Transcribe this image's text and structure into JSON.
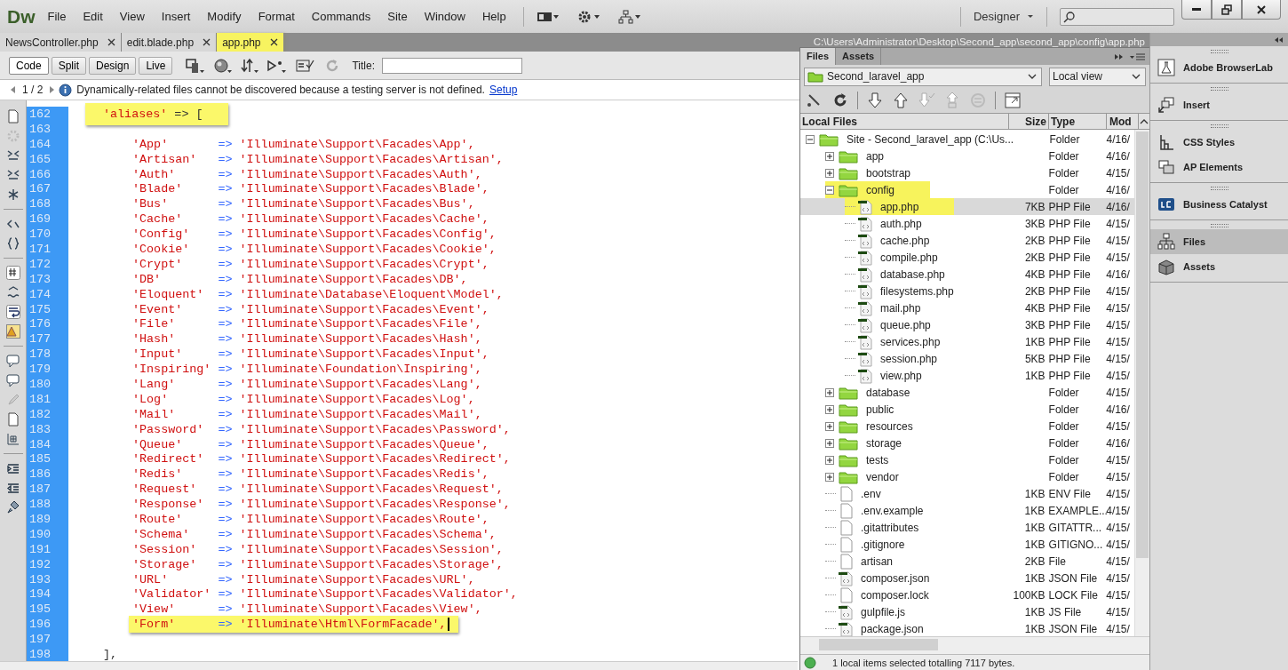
{
  "app_logo": "Dw",
  "menu": [
    "File",
    "Edit",
    "View",
    "Insert",
    "Modify",
    "Format",
    "Commands",
    "Site",
    "Window",
    "Help"
  ],
  "workspace": "Designer",
  "document_tabs": [
    {
      "label": "NewsController.php",
      "selected": false
    },
    {
      "label": "edit.blade.php",
      "selected": false
    },
    {
      "label": "app.php",
      "selected": true
    }
  ],
  "document_path": "C:\\Users\\Administrator\\Desktop\\Second_app\\second_app\\config\\app.php",
  "view_buttons": [
    {
      "label": "Code",
      "selected": true
    },
    {
      "label": "Split",
      "selected": false
    },
    {
      "label": "Design",
      "selected": false
    },
    {
      "label": "Live",
      "selected": false
    }
  ],
  "title_label": "Title:",
  "info_bar": {
    "pager": "1 / 2",
    "message": "Dynamically-related files cannot be discovered because a testing server is not defined.",
    "link": "Setup"
  },
  "code_lines": [
    {
      "number": "162",
      "kind": "open",
      "key": "'aliases'",
      "op": "=> [",
      "highlighted": true,
      "cursor": false
    },
    {
      "number": "163",
      "kind": "blank"
    },
    {
      "number": "164",
      "kind": "pair",
      "key": "'App'",
      "op": "=>",
      "value": "'Illuminate\\Support\\Facades\\App',",
      "highlighted": false,
      "cursor": false
    },
    {
      "number": "165",
      "kind": "pair",
      "key": "'Artisan'",
      "op": "=>",
      "value": "'Illuminate\\Support\\Facades\\Artisan',",
      "highlighted": false,
      "cursor": false
    },
    {
      "number": "166",
      "kind": "pair",
      "key": "'Auth'",
      "op": "=>",
      "value": "'Illuminate\\Support\\Facades\\Auth',",
      "highlighted": false,
      "cursor": false
    },
    {
      "number": "167",
      "kind": "pair",
      "key": "'Blade'",
      "op": "=>",
      "value": "'Illuminate\\Support\\Facades\\Blade',",
      "highlighted": false,
      "cursor": false
    },
    {
      "number": "168",
      "kind": "pair",
      "key": "'Bus'",
      "op": "=>",
      "value": "'Illuminate\\Support\\Facades\\Bus',",
      "highlighted": false,
      "cursor": false
    },
    {
      "number": "169",
      "kind": "pair",
      "key": "'Cache'",
      "op": "=>",
      "value": "'Illuminate\\Support\\Facades\\Cache',",
      "highlighted": false,
      "cursor": false
    },
    {
      "number": "170",
      "kind": "pair",
      "key": "'Config'",
      "op": "=>",
      "value": "'Illuminate\\Support\\Facades\\Config',",
      "highlighted": false,
      "cursor": false
    },
    {
      "number": "171",
      "kind": "pair",
      "key": "'Cookie'",
      "op": "=>",
      "value": "'Illuminate\\Support\\Facades\\Cookie',",
      "highlighted": false,
      "cursor": false
    },
    {
      "number": "172",
      "kind": "pair",
      "key": "'Crypt'",
      "op": "=>",
      "value": "'Illuminate\\Support\\Facades\\Crypt',",
      "highlighted": false,
      "cursor": false
    },
    {
      "number": "173",
      "kind": "pair",
      "key": "'DB'",
      "op": "=>",
      "value": "'Illuminate\\Support\\Facades\\DB',",
      "highlighted": false,
      "cursor": false
    },
    {
      "number": "174",
      "kind": "pair",
      "key": "'Eloquent'",
      "op": "=>",
      "value": "'Illuminate\\Database\\Eloquent\\Model',",
      "highlighted": false,
      "cursor": false
    },
    {
      "number": "175",
      "kind": "pair",
      "key": "'Event'",
      "op": "=>",
      "value": "'Illuminate\\Support\\Facades\\Event',",
      "highlighted": false,
      "cursor": false
    },
    {
      "number": "176",
      "kind": "pair",
      "key": "'File'",
      "op": "=>",
      "value": "'Illuminate\\Support\\Facades\\File',",
      "highlighted": false,
      "cursor": false
    },
    {
      "number": "177",
      "kind": "pair",
      "key": "'Hash'",
      "op": "=>",
      "value": "'Illuminate\\Support\\Facades\\Hash',",
      "highlighted": false,
      "cursor": false
    },
    {
      "number": "178",
      "kind": "pair",
      "key": "'Input'",
      "op": "=>",
      "value": "'Illuminate\\Support\\Facades\\Input',",
      "highlighted": false,
      "cursor": false
    },
    {
      "number": "179",
      "kind": "pair",
      "key": "'Inspiring'",
      "op": "=>",
      "value": "'Illuminate\\Foundation\\Inspiring',",
      "highlighted": false,
      "cursor": false
    },
    {
      "number": "180",
      "kind": "pair",
      "key": "'Lang'",
      "op": "=>",
      "value": "'Illuminate\\Support\\Facades\\Lang',",
      "highlighted": false,
      "cursor": false
    },
    {
      "number": "181",
      "kind": "pair",
      "key": "'Log'",
      "op": "=>",
      "value": "'Illuminate\\Support\\Facades\\Log',",
      "highlighted": false,
      "cursor": false
    },
    {
      "number": "182",
      "kind": "pair",
      "key": "'Mail'",
      "op": "=>",
      "value": "'Illuminate\\Support\\Facades\\Mail',",
      "highlighted": false,
      "cursor": false
    },
    {
      "number": "183",
      "kind": "pair",
      "key": "'Password'",
      "op": "=>",
      "value": "'Illuminate\\Support\\Facades\\Password',",
      "highlighted": false,
      "cursor": false
    },
    {
      "number": "184",
      "kind": "pair",
      "key": "'Queue'",
      "op": "=>",
      "value": "'Illuminate\\Support\\Facades\\Queue',",
      "highlighted": false,
      "cursor": false
    },
    {
      "number": "185",
      "kind": "pair",
      "key": "'Redirect'",
      "op": "=>",
      "value": "'Illuminate\\Support\\Facades\\Redirect',",
      "highlighted": false,
      "cursor": false
    },
    {
      "number": "186",
      "kind": "pair",
      "key": "'Redis'",
      "op": "=>",
      "value": "'Illuminate\\Support\\Facades\\Redis',",
      "highlighted": false,
      "cursor": false
    },
    {
      "number": "187",
      "kind": "pair",
      "key": "'Request'",
      "op": "=>",
      "value": "'Illuminate\\Support\\Facades\\Request',",
      "highlighted": false,
      "cursor": false
    },
    {
      "number": "188",
      "kind": "pair",
      "key": "'Response'",
      "op": "=>",
      "value": "'Illuminate\\Support\\Facades\\Response',",
      "highlighted": false,
      "cursor": false
    },
    {
      "number": "189",
      "kind": "pair",
      "key": "'Route'",
      "op": "=>",
      "value": "'Illuminate\\Support\\Facades\\Route',",
      "highlighted": false,
      "cursor": false
    },
    {
      "number": "190",
      "kind": "pair",
      "key": "'Schema'",
      "op": "=>",
      "value": "'Illuminate\\Support\\Facades\\Schema',",
      "highlighted": false,
      "cursor": false
    },
    {
      "number": "191",
      "kind": "pair",
      "key": "'Session'",
      "op": "=>",
      "value": "'Illuminate\\Support\\Facades\\Session',",
      "highlighted": false,
      "cursor": false
    },
    {
      "number": "192",
      "kind": "pair",
      "key": "'Storage'",
      "op": "=>",
      "value": "'Illuminate\\Support\\Facades\\Storage',",
      "highlighted": false,
      "cursor": false
    },
    {
      "number": "193",
      "kind": "pair",
      "key": "'URL'",
      "op": "=>",
      "value": "'Illuminate\\Support\\Facades\\URL',",
      "highlighted": false,
      "cursor": false
    },
    {
      "number": "194",
      "kind": "pair",
      "key": "'Validator'",
      "op": "=>",
      "value": "'Illuminate\\Support\\Facades\\Validator',",
      "highlighted": false,
      "cursor": false
    },
    {
      "number": "195",
      "kind": "pair",
      "key": "'View'",
      "op": "=>",
      "value": "'Illuminate\\Support\\Facades\\View',",
      "highlighted": false,
      "cursor": false
    },
    {
      "number": "196",
      "kind": "pair",
      "key": "'Form'",
      "op": "=>",
      "value": "'Illuminate\\Html\\FormFacade',",
      "highlighted": true,
      "cursor": true
    },
    {
      "number": "197",
      "kind": "blank"
    },
    {
      "number": "198",
      "kind": "close",
      "op": "],",
      "highlighted": false,
      "cursor": false
    }
  ],
  "files_panel": {
    "tabs": [
      {
        "label": "Files",
        "selected": true
      },
      {
        "label": "Assets",
        "selected": false
      }
    ],
    "site": "Second_laravel_app",
    "view": "Local view",
    "columns": [
      "Local Files",
      "Size",
      "Type",
      "Mod"
    ],
    "tree": [
      {
        "name": "Site - Second_laravel_app (C:\\Us...",
        "kind": "folder",
        "type": "Folder",
        "modified": "4/16/",
        "expanded": true,
        "selected": false,
        "highlighted": false,
        "children": [
          {
            "name": "app",
            "kind": "folder",
            "type": "Folder",
            "modified": "4/16/",
            "expanded": false,
            "selected": false,
            "highlighted": false
          },
          {
            "name": "bootstrap",
            "kind": "folder",
            "type": "Folder",
            "modified": "4/15/",
            "expanded": false,
            "selected": false,
            "highlighted": false
          },
          {
            "name": "config",
            "kind": "folder",
            "type": "Folder",
            "modified": "4/16/",
            "expanded": true,
            "selected": false,
            "highlighted": true,
            "children": [
              {
                "name": "app.php",
                "kind": "code",
                "size": "7KB",
                "type": "PHP File",
                "modified": "4/16/",
                "selected": true,
                "highlighted": true
              },
              {
                "name": "auth.php",
                "kind": "code",
                "size": "3KB",
                "type": "PHP File",
                "modified": "4/15/",
                "selected": false,
                "highlighted": false
              },
              {
                "name": "cache.php",
                "kind": "code",
                "size": "2KB",
                "type": "PHP File",
                "modified": "4/15/",
                "selected": false,
                "highlighted": false
              },
              {
                "name": "compile.php",
                "kind": "code",
                "size": "2KB",
                "type": "PHP File",
                "modified": "4/15/",
                "selected": false,
                "highlighted": false
              },
              {
                "name": "database.php",
                "kind": "code",
                "size": "4KB",
                "type": "PHP File",
                "modified": "4/16/",
                "selected": false,
                "highlighted": false
              },
              {
                "name": "filesystems.php",
                "kind": "code",
                "size": "2KB",
                "type": "PHP File",
                "modified": "4/15/",
                "selected": false,
                "highlighted": false
              },
              {
                "name": "mail.php",
                "kind": "code",
                "size": "4KB",
                "type": "PHP File",
                "modified": "4/15/",
                "selected": false,
                "highlighted": false
              },
              {
                "name": "queue.php",
                "kind": "code",
                "size": "3KB",
                "type": "PHP File",
                "modified": "4/15/",
                "selected": false,
                "highlighted": false
              },
              {
                "name": "services.php",
                "kind": "code",
                "size": "1KB",
                "type": "PHP File",
                "modified": "4/15/",
                "selected": false,
                "highlighted": false
              },
              {
                "name": "session.php",
                "kind": "code",
                "size": "5KB",
                "type": "PHP File",
                "modified": "4/15/",
                "selected": false,
                "highlighted": false
              },
              {
                "name": "view.php",
                "kind": "code",
                "size": "1KB",
                "type": "PHP File",
                "modified": "4/15/",
                "selected": false,
                "highlighted": false
              }
            ]
          },
          {
            "name": "database",
            "kind": "folder",
            "type": "Folder",
            "modified": "4/15/",
            "expanded": false,
            "selected": false,
            "highlighted": false
          },
          {
            "name": "public",
            "kind": "folder",
            "type": "Folder",
            "modified": "4/16/",
            "expanded": false,
            "selected": false,
            "highlighted": false
          },
          {
            "name": "resources",
            "kind": "folder",
            "type": "Folder",
            "modified": "4/15/",
            "expanded": false,
            "selected": false,
            "highlighted": false
          },
          {
            "name": "storage",
            "kind": "folder",
            "type": "Folder",
            "modified": "4/16/",
            "expanded": false,
            "selected": false,
            "highlighted": false
          },
          {
            "name": "tests",
            "kind": "folder",
            "type": "Folder",
            "modified": "4/15/",
            "expanded": false,
            "selected": false,
            "highlighted": false
          },
          {
            "name": "vendor",
            "kind": "folder",
            "type": "Folder",
            "modified": "4/15/",
            "expanded": false,
            "selected": false,
            "highlighted": false
          },
          {
            "name": ".env",
            "kind": "plain",
            "size": "1KB",
            "type": "ENV File",
            "modified": "4/15/",
            "selected": false,
            "highlighted": false
          },
          {
            "name": ".env.example",
            "kind": "plain",
            "size": "1KB",
            "type": "EXAMPLE...",
            "modified": "4/15/",
            "selected": false,
            "highlighted": false
          },
          {
            "name": ".gitattributes",
            "kind": "plain",
            "size": "1KB",
            "type": "GITATTR...",
            "modified": "4/15/",
            "selected": false,
            "highlighted": false
          },
          {
            "name": ".gitignore",
            "kind": "plain",
            "size": "1KB",
            "type": "GITIGNO...",
            "modified": "4/15/",
            "selected": false,
            "highlighted": false
          },
          {
            "name": "artisan",
            "kind": "plain",
            "size": "2KB",
            "type": "File",
            "modified": "4/15/",
            "selected": false,
            "highlighted": false
          },
          {
            "name": "composer.json",
            "kind": "code",
            "size": "1KB",
            "type": "JSON File",
            "modified": "4/15/",
            "selected": false,
            "highlighted": false
          },
          {
            "name": "composer.lock",
            "kind": "plain",
            "size": "100KB",
            "type": "LOCK File",
            "modified": "4/15/",
            "selected": false,
            "highlighted": false
          },
          {
            "name": "gulpfile.js",
            "kind": "code",
            "size": "1KB",
            "type": "JS File",
            "modified": "4/15/",
            "selected": false,
            "highlighted": false
          },
          {
            "name": "package.json",
            "kind": "code",
            "size": "1KB",
            "type": "JSON File",
            "modified": "4/15/",
            "selected": false,
            "highlighted": false
          }
        ]
      }
    ],
    "status": "1 local items selected totalling 7117 bytes."
  },
  "side_panel": [
    [
      {
        "label": "Adobe BrowserLab",
        "kind": "flask",
        "selected": false
      }
    ],
    [
      {
        "label": "Insert",
        "kind": "insert",
        "selected": false
      }
    ],
    [
      {
        "label": "CSS Styles",
        "kind": "styles",
        "selected": false
      },
      {
        "label": "AP Elements",
        "kind": "layers",
        "selected": false
      }
    ],
    [
      {
        "label": "Business Catalyst",
        "kind": "catalyst",
        "selected": false
      }
    ],
    [
      {
        "label": "Files",
        "kind": "sitemap",
        "selected": true
      },
      {
        "label": "Assets",
        "kind": "box",
        "selected": false
      }
    ]
  ]
}
